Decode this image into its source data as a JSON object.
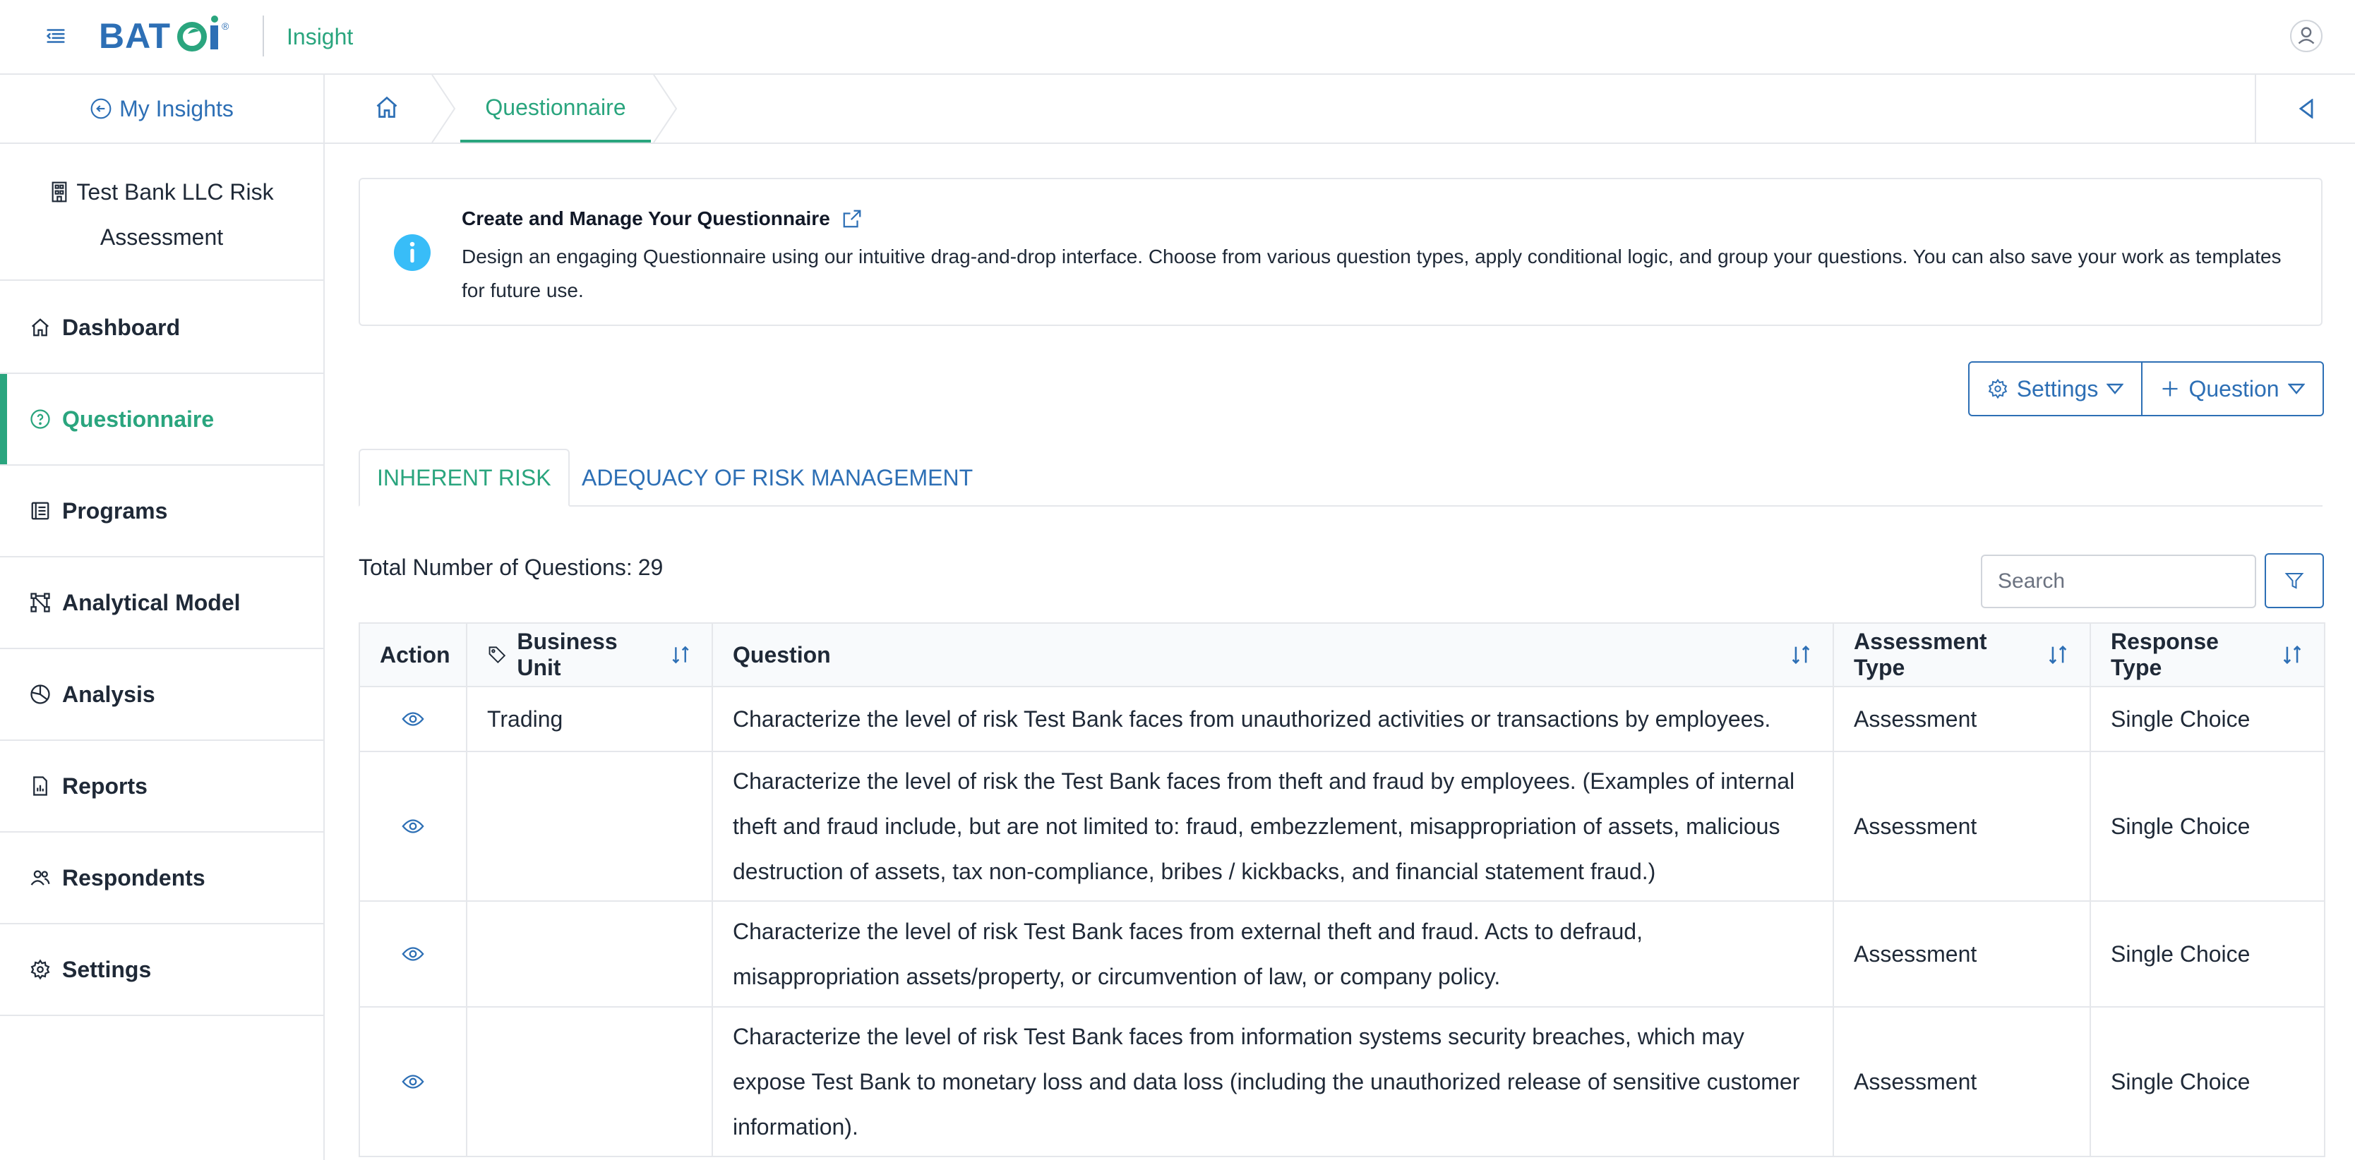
{
  "app": {
    "brand": "BATOI",
    "name": "Insight",
    "accent_color": "#2aa57e",
    "link_color": "#2d6fb5"
  },
  "sidebar": {
    "back_label": "My Insights",
    "project_line1": "Test Bank LLC Risk",
    "project_line2": "Assessment",
    "items": [
      {
        "label": "Dashboard",
        "icon": "home-icon"
      },
      {
        "label": "Questionnaire",
        "icon": "question-circle-icon",
        "active": true
      },
      {
        "label": "Programs",
        "icon": "list-icon"
      },
      {
        "label": "Analytical Model",
        "icon": "model-icon"
      },
      {
        "label": "Analysis",
        "icon": "pie-icon"
      },
      {
        "label": "Reports",
        "icon": "report-icon"
      },
      {
        "label": "Respondents",
        "icon": "users-icon"
      },
      {
        "label": "Settings",
        "icon": "gear-icon"
      }
    ]
  },
  "breadcrumb": {
    "current": "Questionnaire"
  },
  "info": {
    "title": "Create and Manage Your Questionnaire",
    "description": "Design an engaging Questionnaire using our intuitive drag-and-drop interface. Choose from various question types, apply conditional logic, and group your questions. You can also save your work as templates for future use."
  },
  "toolbar": {
    "settings_label": "Settings",
    "question_label": "Question"
  },
  "tabs": [
    {
      "label": "INHERENT RISK",
      "active": true
    },
    {
      "label": "ADEQUACY OF RISK MANAGEMENT",
      "active": false
    }
  ],
  "summary": {
    "total_label": "Total Number of Questions:",
    "total_value": "29"
  },
  "search": {
    "placeholder": "Search"
  },
  "table": {
    "headers": {
      "action": "Action",
      "business_unit": "Business Unit",
      "question": "Question",
      "assessment_type": "Assessment Type",
      "response_type": "Response Type"
    },
    "rows": [
      {
        "business_unit": "Trading",
        "question": "Characterize the level of risk Test Bank faces from unauthorized activities or transactions by employees.",
        "assessment_type": "Assessment",
        "response_type": "Single Choice"
      },
      {
        "business_unit": "",
        "question": "Characterize the level of risk the Test Bank faces from theft and fraud by employees. (Examples of internal theft and fraud include, but are not limited to: fraud, embezzlement, misappropriation of assets, malicious destruction of assets, tax non-compliance, bribes / kickbacks, and financial statement fraud.)",
        "assessment_type": "Assessment",
        "response_type": "Single Choice"
      },
      {
        "business_unit": "",
        "question": "Characterize the level of risk Test Bank faces from external theft and fraud. Acts to defraud, misappropriation assets/property, or circumvention of law, or company policy.",
        "assessment_type": "Assessment",
        "response_type": "Single Choice"
      },
      {
        "business_unit": "",
        "question": "Characterize the level of risk Test Bank faces from information systems security breaches, which may expose Test Bank to monetary loss and data loss (including the unauthorized release of sensitive customer information).",
        "assessment_type": "Assessment",
        "response_type": "Single Choice"
      }
    ]
  }
}
